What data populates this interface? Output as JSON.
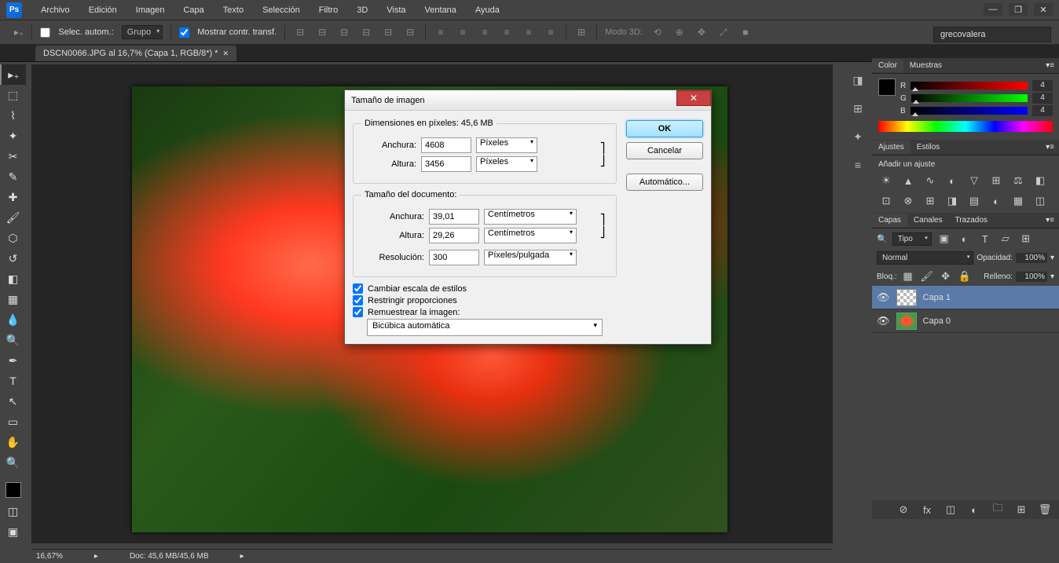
{
  "menu": {
    "archivo": "Archivo",
    "edicion": "Edición",
    "imagen": "Imagen",
    "capa": "Capa",
    "texto": "Texto",
    "seleccion": "Selección",
    "filtro": "Filtro",
    "tresd": "3D",
    "vista": "Vista",
    "ventana": "Ventana",
    "ayuda": "Ayuda"
  },
  "optbar": {
    "autoselect": "Selec. autom.:",
    "grupo": "Grupo",
    "mostrar": "Mostrar contr. transf.",
    "modo3d": "Modo 3D:"
  },
  "user": "grecovalera",
  "tab": {
    "label": "DSCN0066.JPG al 16,7% (Capa 1, RGB/8*) *"
  },
  "dialog": {
    "title": "Tamaño de imagen",
    "pixelDims": "Dimensiones en píxeles: 45,6 MB",
    "anchura": "Anchura:",
    "altura": "Altura:",
    "resolucion": "Resolución:",
    "pixW": "4608",
    "pixH": "3456",
    "unitPix": "Píxeles",
    "docTitle": "Tamaño del documento:",
    "docW": "39,01",
    "docH": "29,26",
    "unitCm": "Centímetros",
    "res": "300",
    "unitRes": "Píxeles/pulgada",
    "chkEscala": "Cambiar escala de estilos",
    "chkRestr": "Restringir proporciones",
    "chkRem": "Remuestrear la imagen:",
    "resample": "Bicúbica automática",
    "ok": "OK",
    "cancel": "Cancelar",
    "auto": "Automático..."
  },
  "color": {
    "tab1": "Color",
    "tab2": "Muestras",
    "r": "R",
    "g": "G",
    "b": "B",
    "rv": "4",
    "gv": "4",
    "bv": "4"
  },
  "adjust": {
    "tab1": "Ajustes",
    "tab2": "Estilos",
    "title": "Añadir un ajuste"
  },
  "layers": {
    "tab1": "Capas",
    "tab2": "Canales",
    "tab3": "Trazados",
    "tipoLabel": "Tipo",
    "normal": "Normal",
    "opacidad": "Opacidad:",
    "op": "100%",
    "bloq": "Bloq.:",
    "relleno": "Relleno:",
    "rel": "100%",
    "items": [
      {
        "name": "Capa 1"
      },
      {
        "name": "Capa 0"
      }
    ]
  },
  "status": {
    "zoom": "16,67%",
    "doc": "Doc: 45,6 MB/45,6 MB"
  }
}
